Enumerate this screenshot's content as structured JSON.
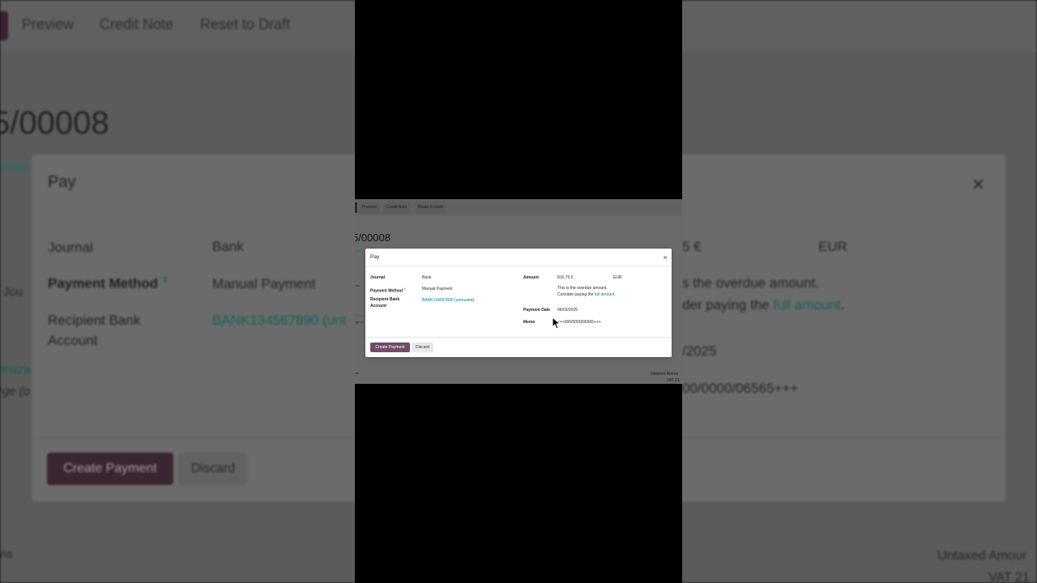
{
  "toolbar": {
    "preview": "Preview",
    "credit_note": "Credit Note",
    "reset_to_draft": "Reset to Draft"
  },
  "invoice": {
    "number_fragment": "5/00008",
    "customer_fragment": "Peter"
  },
  "modal": {
    "title": "Pay",
    "close_symbol": "×",
    "journal_label": "Journal",
    "journal_value": "Bank",
    "payment_method_label": "Payment Method",
    "payment_method_help": "?",
    "payment_method_value": "Manual Payment",
    "recipient_label_line1": "Recipient Bank",
    "recipient_label_line2": "Account",
    "recipient_value": "BANK134567890 (untrusted)",
    "amount_label": "Amount",
    "amount_value": "816.75 €",
    "currency_value": "EUR",
    "overdue_note": "This is the overdue amount.",
    "consider_prefix": "Consider paying the ",
    "full_amount_link": "full amount",
    "consider_suffix": ".",
    "payment_date_label": "Payment Date",
    "payment_date_value": "06/03/2025",
    "memo_label": "Memo",
    "memo_value": "+++000/0000/06565+++",
    "create_payment": "Create Payment",
    "discard": "Discard"
  },
  "background_fragments": {
    "bank_account_partial": "BANK134567890 (unt",
    "amount_partial": "5 €",
    "overdue_partial": "s the overdue amount.",
    "consider_partial": "der paying the ",
    "full_amount_partial": "full amount",
    "date_partial": "/2025",
    "memo_partial": "00/0000/06565+++",
    "side_jou": "Jou",
    "side_omiza": "omiza",
    "side_rge": "rge (o",
    "side_ns": "ns",
    "untaxed_partial": "Untaxed Amour",
    "vat_partial": "VAT 21"
  },
  "colors": {
    "brand_purple": "#714b67",
    "link_teal": "#017e84"
  }
}
